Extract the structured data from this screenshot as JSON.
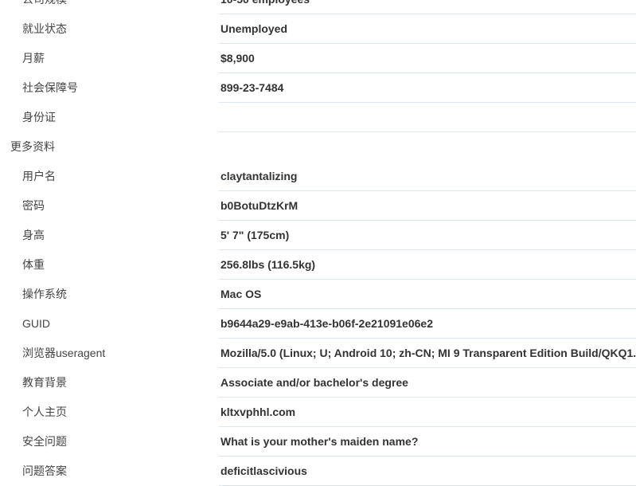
{
  "profile": {
    "rows_top": [
      {
        "label": "公司规模",
        "value": "10-50 employees"
      },
      {
        "label": "就业状态",
        "value": "Unemployed"
      },
      {
        "label": "月薪",
        "value": "$8,900"
      },
      {
        "label": "社会保障号",
        "value": "899-23-7484"
      },
      {
        "label": "身份证",
        "value": ""
      }
    ],
    "more_section_title": "更多资料",
    "rows_more": [
      {
        "label": "用户名",
        "value": "claytantalizing"
      },
      {
        "label": "密码",
        "value": "b0BotuDtzKrM"
      },
      {
        "label": "身高",
        "value": "5' 7\" (175cm)"
      },
      {
        "label": "体重",
        "value": "256.8lbs (116.5kg)"
      },
      {
        "label": "操作系统",
        "value": "Mac OS"
      },
      {
        "label": "GUID",
        "value": "b9644a29-e9ab-413e-b06f-2e21091e06e2"
      },
      {
        "label": "浏览器useragent",
        "value": "Mozilla/5.0 (Linux; U; Android 10; zh-CN; MI 9 Transparent Edition Build/QKQ1."
      },
      {
        "label": "教育背景",
        "value": "Associate and/or bachelor's degree"
      },
      {
        "label": "个人主页",
        "value": "kltxvphhl.com"
      },
      {
        "label": "安全问题",
        "value": "What is your mother's maiden name?"
      },
      {
        "label": "问题答案",
        "value": "deficitlascivious"
      }
    ]
  }
}
